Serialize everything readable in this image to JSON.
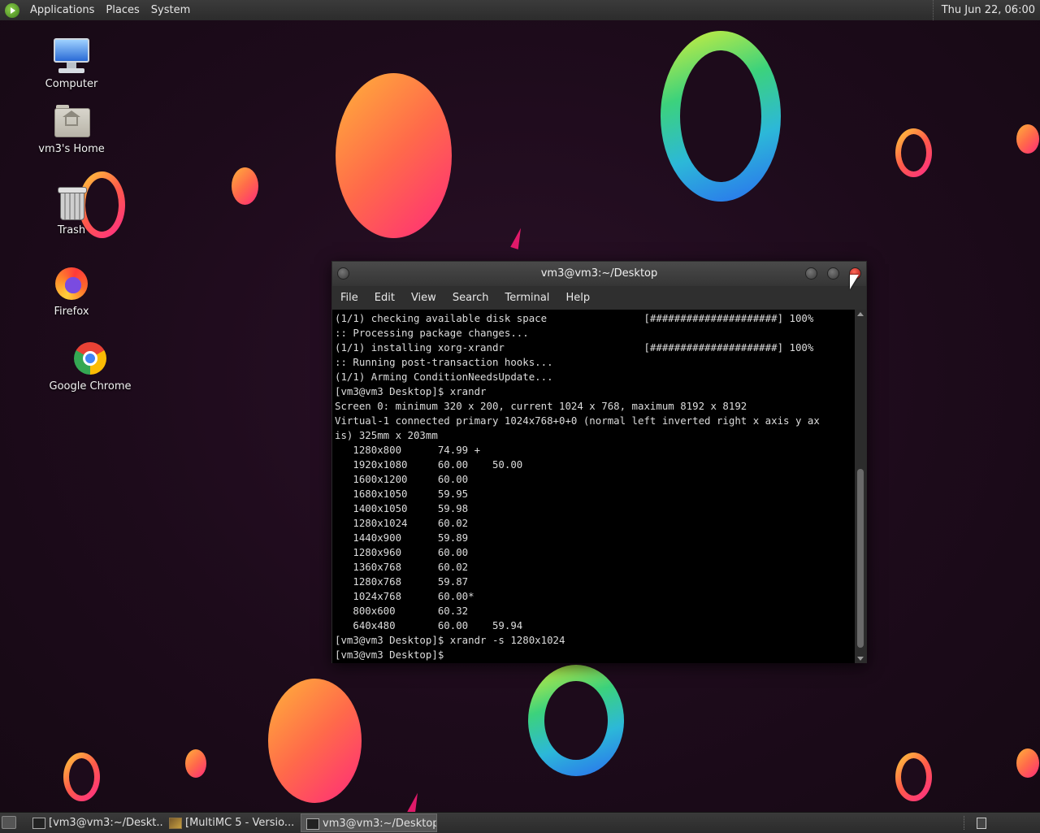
{
  "top_panel": {
    "menus": [
      "Applications",
      "Places",
      "System"
    ],
    "clock": "Thu Jun 22, 06:00"
  },
  "desktop_icons": [
    {
      "label": "Computer",
      "icon": "computer-icon"
    },
    {
      "label": "vm3's Home",
      "icon": "home-folder-icon"
    },
    {
      "label": "Trash",
      "icon": "trash-icon"
    },
    {
      "label": "Firefox",
      "icon": "firefox-icon"
    },
    {
      "label": "Google Chrome",
      "icon": "chrome-icon"
    }
  ],
  "terminal": {
    "title": "vm3@vm3:~/Desktop",
    "menu": [
      "File",
      "Edit",
      "View",
      "Search",
      "Terminal",
      "Help"
    ],
    "lines": [
      "(1/1) checking available disk space                [#####################] 100%",
      ":: Processing package changes...",
      "(1/1) installing xorg-xrandr                       [#####################] 100%",
      ":: Running post-transaction hooks...",
      "(1/1) Arming ConditionNeedsUpdate...",
      "[vm3@vm3 Desktop]$ xrandr",
      "Screen 0: minimum 320 x 200, current 1024 x 768, maximum 8192 x 8192",
      "Virtual-1 connected primary 1024x768+0+0 (normal left inverted right x axis y ax",
      "is) 325mm x 203mm",
      "   1280x800      74.99 +",
      "   1920x1080     60.00    50.00",
      "   1600x1200     60.00",
      "   1680x1050     59.95",
      "   1400x1050     59.98",
      "   1280x1024     60.02",
      "   1440x900      59.89",
      "   1280x960      60.00",
      "   1360x768      60.02",
      "   1280x768      59.87",
      "   1024x768      60.00*",
      "   800x600       60.32",
      "   640x480       60.00    59.94",
      "[vm3@vm3 Desktop]$ xrandr -s 1280x1024",
      "[vm3@vm3 Desktop]$ "
    ]
  },
  "taskbar": {
    "tasks": [
      {
        "label": "[vm3@vm3:~/Deskt...",
        "active": false
      },
      {
        "label": "[MultiMC 5 - Versio...",
        "active": false
      },
      {
        "label": "vm3@vm3:~/Desktop",
        "active": true
      }
    ]
  },
  "colors": {
    "background": "#1d0b1b",
    "warm_gradient": [
      "#ffb23a",
      "#ff6a4a",
      "#ff2a7a"
    ],
    "cool_gradient": [
      "#d6f03a",
      "#3cd27c",
      "#2cb8d8",
      "#2a6cf0"
    ]
  }
}
